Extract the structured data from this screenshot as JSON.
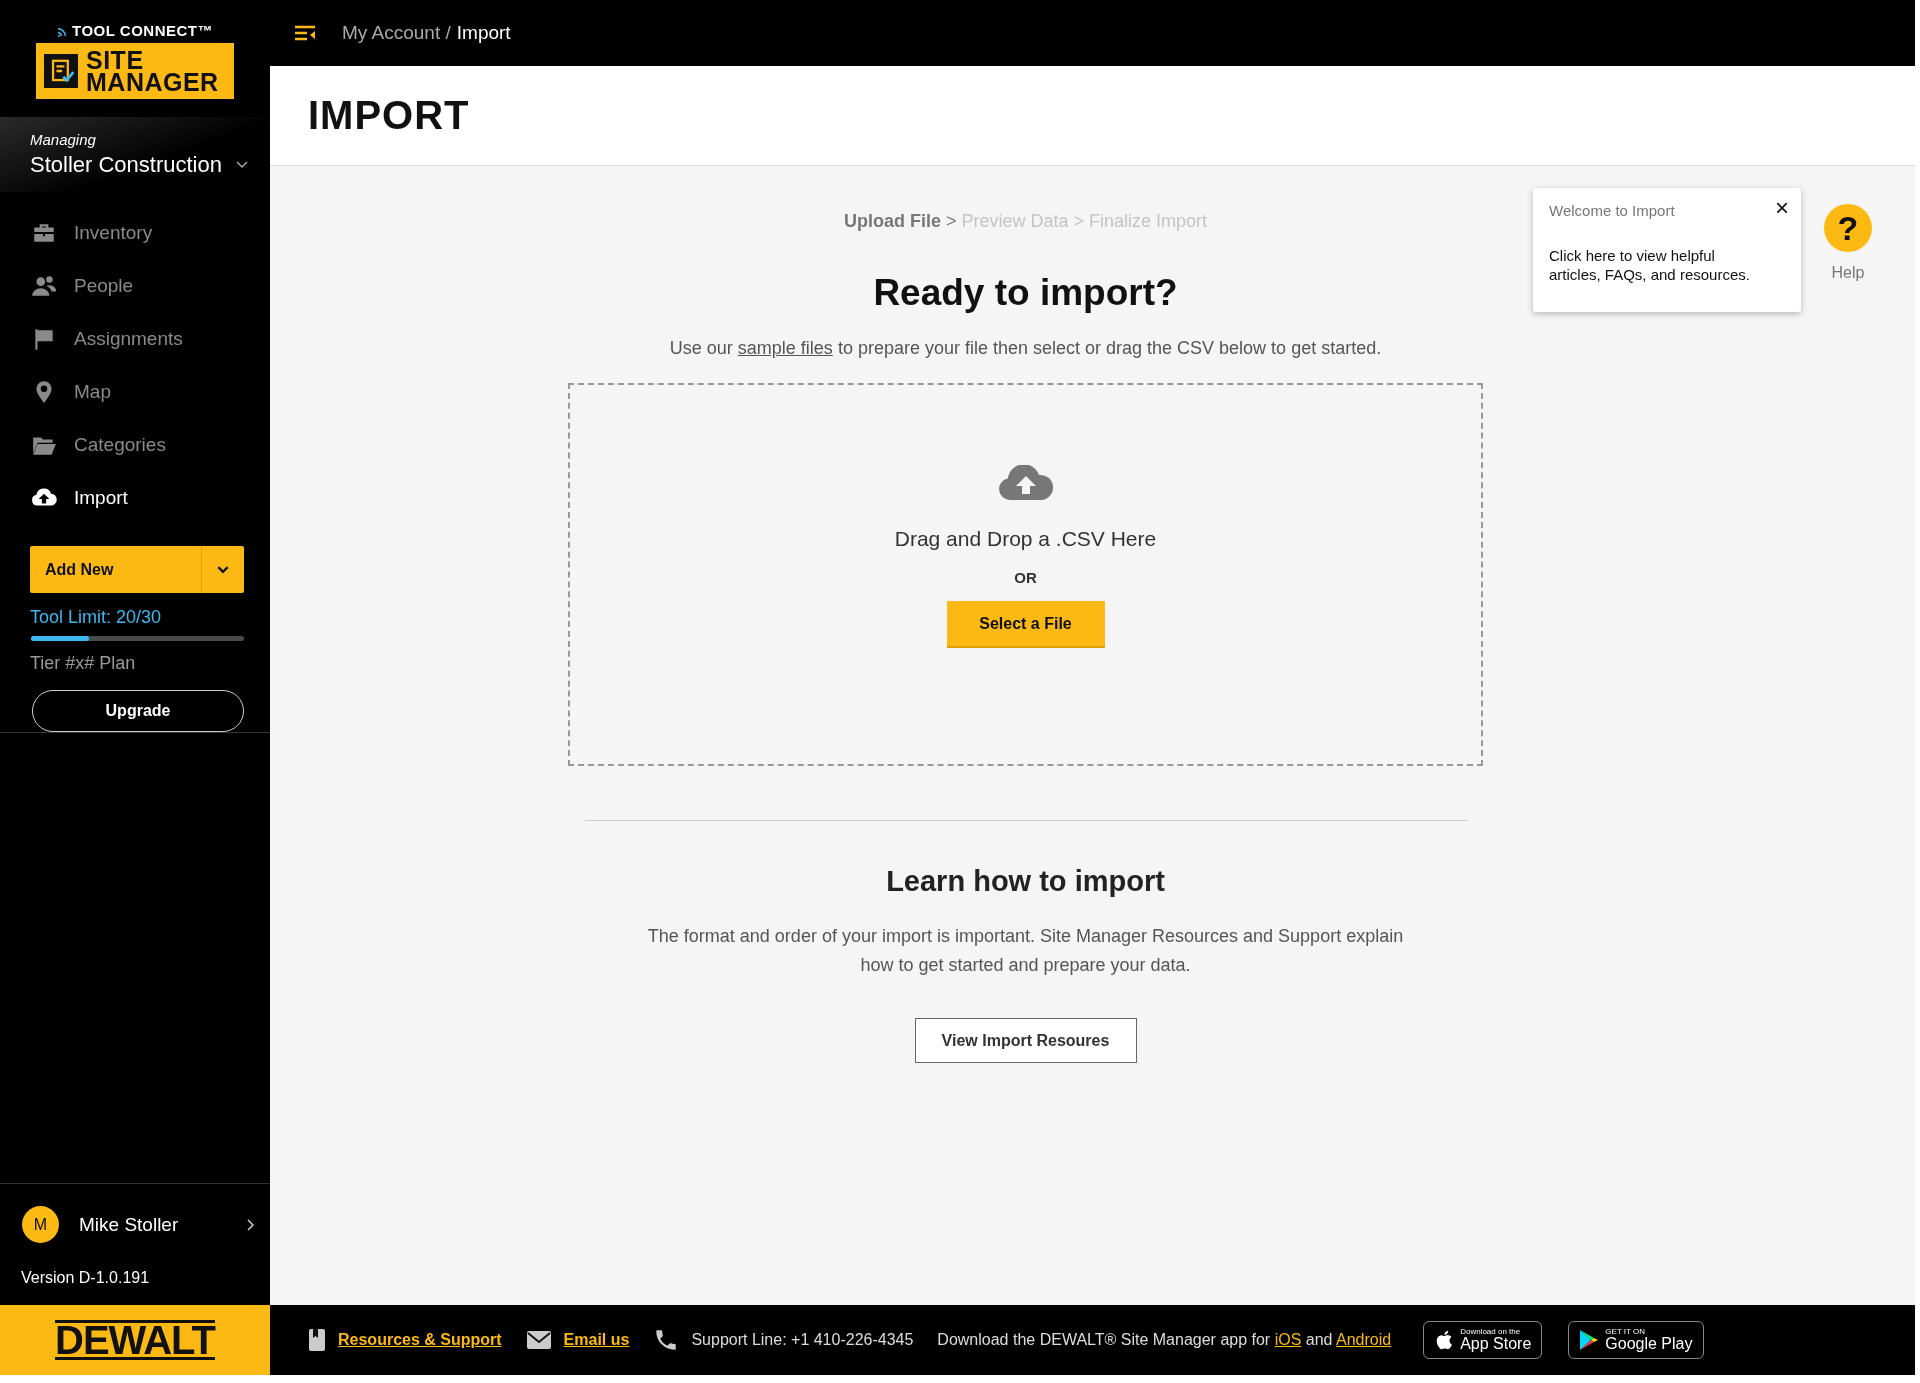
{
  "brand": {
    "top": "TOOL CONNECT™",
    "line1": "SITE",
    "line2": "MANAGER"
  },
  "account": {
    "label": "Managing",
    "name": "Stoller Construction"
  },
  "nav": [
    {
      "kind": "inventory",
      "label": "Inventory",
      "selected": false
    },
    {
      "kind": "people",
      "label": "People",
      "selected": false
    },
    {
      "kind": "assignments",
      "label": "Assignments",
      "selected": false
    },
    {
      "kind": "map",
      "label": "Map",
      "selected": false
    },
    {
      "kind": "categories",
      "label": "Categories",
      "selected": false
    },
    {
      "kind": "import",
      "label": "Import",
      "selected": true
    }
  ],
  "add_new": "Add New",
  "tool_limit": {
    "label": "Tool Limit: 20/30",
    "level": 0.27,
    "plan": "Tier #x# Plan",
    "upgrade": "Upgrade"
  },
  "user": {
    "initial": "M",
    "name": "Mike Stoller",
    "version": "Version D-1.0.191"
  },
  "footer_logo": "DEWALT",
  "breadcrumb": {
    "parent": "My Account /",
    "current": "Import"
  },
  "page_title": "IMPORT",
  "steps": [
    {
      "label": "Upload File",
      "active": true
    },
    {
      "label": "Preview Data",
      "active": false
    },
    {
      "label": "Finalize Import",
      "active": false
    }
  ],
  "step_separator": ">",
  "heading": "Ready to import?",
  "intro": {
    "before": "Use our",
    "link": "sample files",
    "after": "to prepare your file then select or drag the CSV below to get started."
  },
  "dropzone": {
    "text": "Drag and Drop a .CSV Here",
    "or": "OR",
    "button": "Select a File"
  },
  "learn": {
    "heading": "Learn how to import",
    "text": "The format and order of your import is important. Site Manager Resources and Support explain how to get started and prepare your data.",
    "button": "View Import Resoures"
  },
  "popover": {
    "title": "Welcome to Import",
    "close": "×",
    "text": "Click here to view helpful articles, FAQs, and resources."
  },
  "help": {
    "symbol": "?",
    "label": "Help"
  },
  "footer": {
    "resources": "Resources & Support",
    "email": "Email us",
    "support": "Support Line: +1 410-226-4345",
    "download_before": "Download the DEWALT® Site Manager app for",
    "ios": "iOS",
    "and": "and",
    "android": "Android",
    "appstore": {
      "small": "Download on the",
      "big": "App Store"
    },
    "googleplay": {
      "small": "GET IT ON",
      "big": "Google Play"
    }
  }
}
